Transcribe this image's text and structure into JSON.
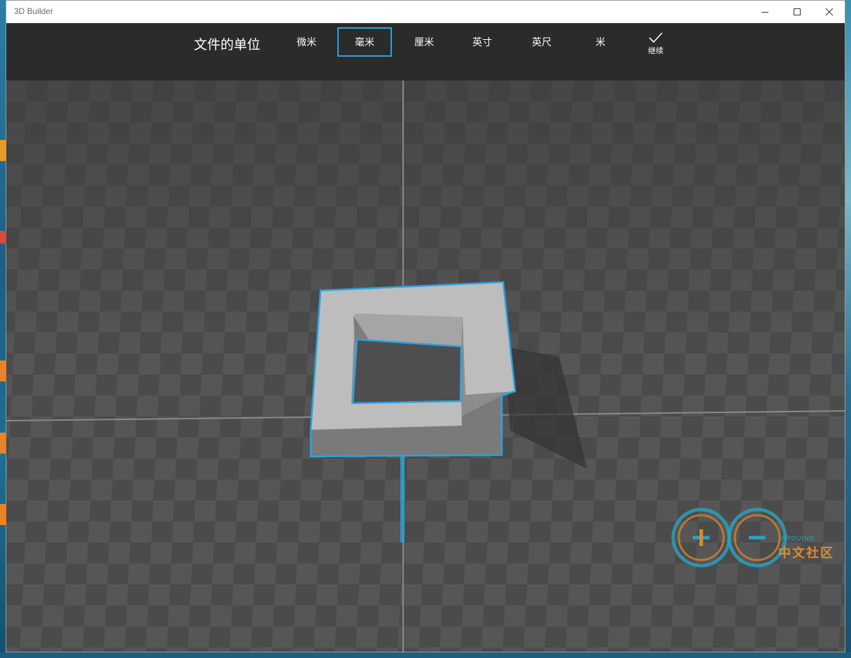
{
  "window": {
    "title": "3D Builder"
  },
  "toolbar": {
    "heading": "文件的单位",
    "units": [
      {
        "label": "微米",
        "selected": false
      },
      {
        "label": "毫米",
        "selected": true
      },
      {
        "label": "厘米",
        "selected": false
      },
      {
        "label": "英寸",
        "selected": false
      },
      {
        "label": "英尺",
        "selected": false
      },
      {
        "label": "米",
        "selected": false
      }
    ],
    "continue_label": "继续",
    "continue_icon": "checkmark-icon"
  },
  "colors": {
    "accent": "#2aa3e0",
    "toolbar_bg": "#2b2b2b",
    "grid_dark": "#3f3f3f",
    "grid_light": "#555555",
    "model": "#b9b9b9"
  },
  "watermark": {
    "brand": "ARDUINO",
    "text": "中文社区"
  }
}
